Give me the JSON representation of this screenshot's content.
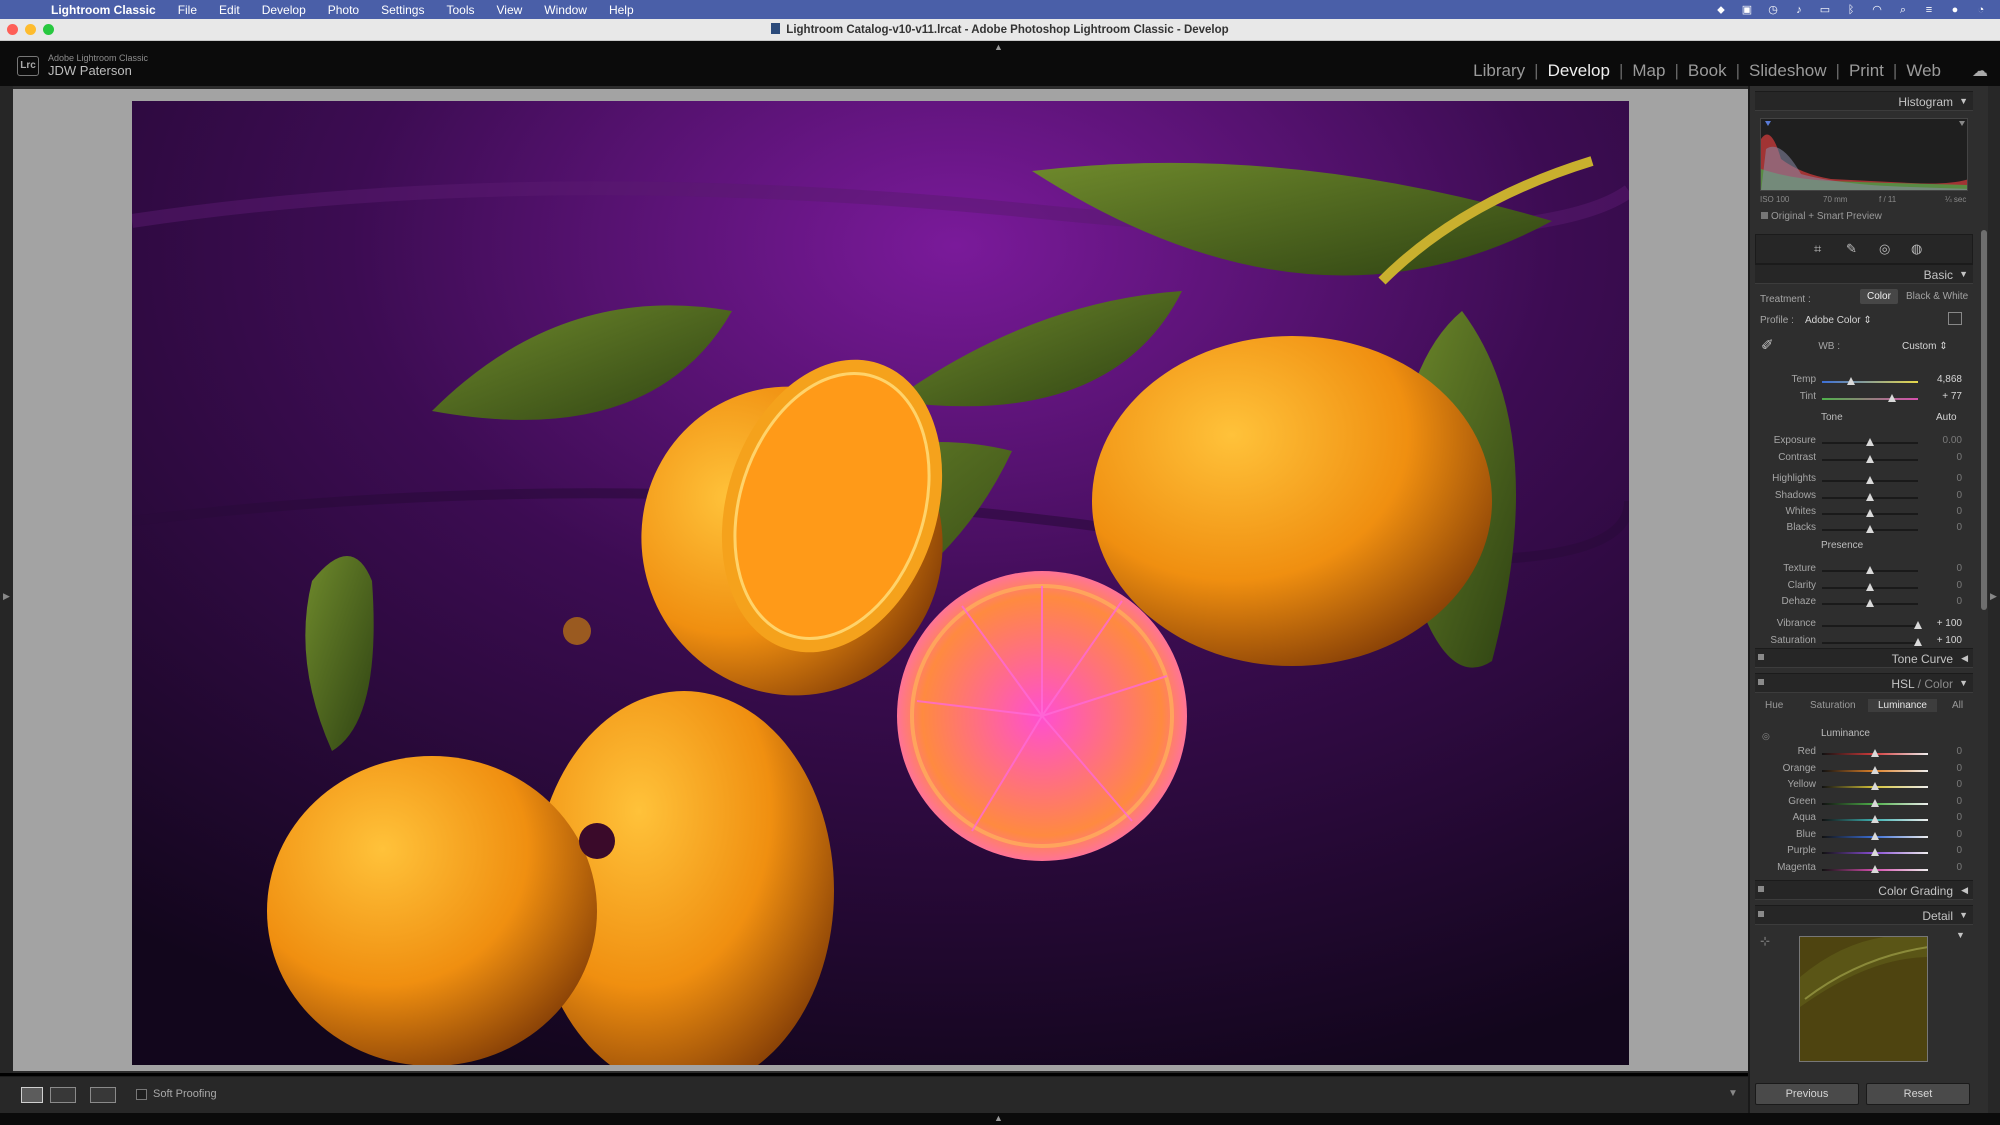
{
  "menubar": {
    "app_name": "Lightroom Classic",
    "items": [
      "File",
      "Edit",
      "Develop",
      "Photo",
      "Settings",
      "Tools",
      "View",
      "Window",
      "Help"
    ]
  },
  "window": {
    "title": "Lightroom Catalog-v10-v11.lrcat - Adobe Photoshop Lightroom Classic - Develop"
  },
  "identity": {
    "logo_text": "Lrc",
    "product": "Adobe Lightroom Classic",
    "user": "JDW Paterson"
  },
  "modules": {
    "items": [
      "Library",
      "Develop",
      "Map",
      "Book",
      "Slideshow",
      "Print",
      "Web"
    ],
    "active": "Develop"
  },
  "toolbar": {
    "soft_proofing": "Soft Proofing"
  },
  "histogram": {
    "title": "Histogram",
    "iso": "ISO 100",
    "focal": "70 mm",
    "aperture": "f / 11",
    "shutter": "¼ sec",
    "preview": "Original + Smart Preview"
  },
  "basic": {
    "title": "Basic",
    "treatment_label": "Treatment :",
    "treatment_color": "Color",
    "treatment_bw": "Black & White",
    "profile_label": "Profile :",
    "profile_value": "Adobe Color",
    "wb_label": "WB :",
    "wb_value": "Custom",
    "tone_label": "Tone",
    "auto_label": "Auto",
    "presence_label": "Presence",
    "sliders": [
      {
        "label": "Temp",
        "value": "4,868",
        "pos": 0.3
      },
      {
        "label": "Tint",
        "value": "+ 77",
        "pos": 0.73
      },
      {
        "label": "Exposure",
        "value": "0.00",
        "pos": 0.5
      },
      {
        "label": "Contrast",
        "value": "0",
        "pos": 0.5
      },
      {
        "label": "Highlights",
        "value": "0",
        "pos": 0.5
      },
      {
        "label": "Shadows",
        "value": "0",
        "pos": 0.5
      },
      {
        "label": "Whites",
        "value": "0",
        "pos": 0.5
      },
      {
        "label": "Blacks",
        "value": "0",
        "pos": 0.5
      },
      {
        "label": "Texture",
        "value": "0",
        "pos": 0.5
      },
      {
        "label": "Clarity",
        "value": "0",
        "pos": 0.5
      },
      {
        "label": "Dehaze",
        "value": "0",
        "pos": 0.5
      },
      {
        "label": "Vibrance",
        "value": "+ 100",
        "pos": 1.0
      },
      {
        "label": "Saturation",
        "value": "+ 100",
        "pos": 1.0
      }
    ]
  },
  "panels": {
    "tone_curve": "Tone Curve",
    "hsl": "HSL",
    "hsl_color": "Color",
    "color_grading": "Color Grading",
    "detail": "Detail"
  },
  "hsl": {
    "tabs": [
      "Hue",
      "Saturation",
      "Luminance",
      "All"
    ],
    "active_tab": "Luminance",
    "section": "Luminance",
    "sliders": [
      {
        "label": "Red",
        "value": "0",
        "pos": 0.5,
        "color": "#d43c3c"
      },
      {
        "label": "Orange",
        "value": "0",
        "pos": 0.5,
        "color": "#e0832a"
      },
      {
        "label": "Yellow",
        "value": "0",
        "pos": 0.5,
        "color": "#d6c43a"
      },
      {
        "label": "Green",
        "value": "0",
        "pos": 0.5,
        "color": "#4fb14a"
      },
      {
        "label": "Aqua",
        "value": "0",
        "pos": 0.5,
        "color": "#3fb3b3"
      },
      {
        "label": "Blue",
        "value": "0",
        "pos": 0.5,
        "color": "#3c6fd6"
      },
      {
        "label": "Purple",
        "value": "0",
        "pos": 0.5,
        "color": "#8a4fd6"
      },
      {
        "label": "Magenta",
        "value": "0",
        "pos": 0.5,
        "color": "#d64fae"
      }
    ]
  },
  "buttons": {
    "previous": "Previous",
    "reset": "Reset"
  }
}
